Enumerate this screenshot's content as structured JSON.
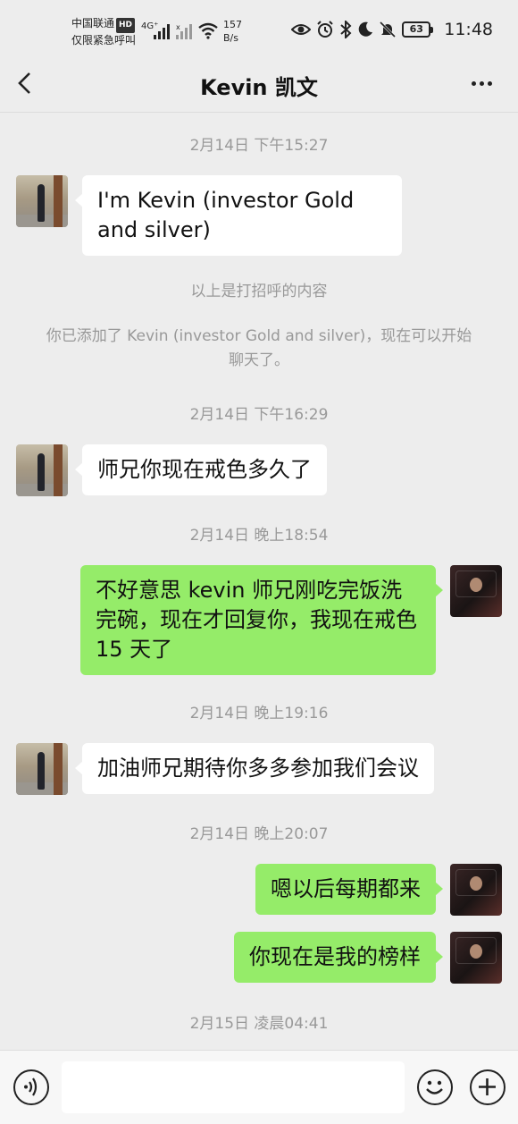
{
  "status_bar": {
    "carrier": "中国联通",
    "hd": "HD",
    "emergency": "仅限紧急呼叫",
    "network": "4G⁺",
    "speed_value": "157",
    "speed_unit": "B/s",
    "battery": "63",
    "time": "11:48"
  },
  "header": {
    "title": "Kevin 凯文"
  },
  "chat": {
    "ts1": "2月14日 下午15:27",
    "msg1": "I'm Kevin (investor Gold and silver)",
    "sys1": "以上是打招呼的内容",
    "sys2": "你已添加了 Kevin (investor Gold and silver)，现在可以开始聊天了。",
    "ts2": "2月14日 下午16:29",
    "msg2": "师兄你现在戒色多久了",
    "ts3": "2月14日 晚上18:54",
    "msg3": "不好意思 kevin 师兄刚吃完饭洗完碗，现在才回复你，我现在戒色15 天了",
    "ts4": "2月14日 晚上19:16",
    "msg4": "加油师兄期待你多多参加我们会议",
    "ts5": "2月14日 晚上20:07",
    "msg5": "嗯以后每期都来",
    "msg6": "你现在是我的榜样",
    "ts6": "2月15日 凌晨04:41"
  },
  "input_bar": {
    "placeholder": ""
  },
  "icons": {
    "back": "chevron-left-icon",
    "more": "more-dots-icon",
    "voice": "voice-icon",
    "emoji": "emoji-icon",
    "plus": "plus-icon"
  },
  "colors": {
    "background": "#ededed",
    "incoming_bubble": "#ffffff",
    "outgoing_bubble": "#95ec69",
    "timestamp": "#999999"
  }
}
